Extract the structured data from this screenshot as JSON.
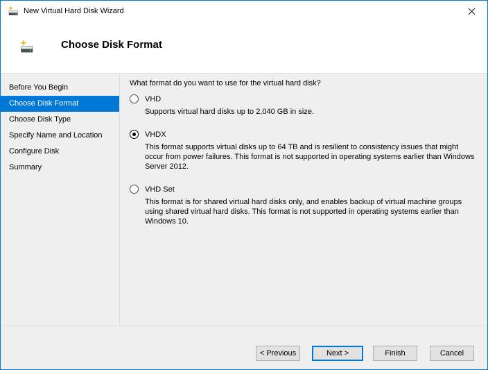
{
  "window": {
    "title": "New Virtual Hard Disk Wizard"
  },
  "icons": {
    "titlebar_app": "new-virtual-hard-disk-icon",
    "header": "new-virtual-hard-disk-icon",
    "close": "close-x-icon"
  },
  "header": {
    "title": "Choose Disk Format"
  },
  "sidebar": {
    "items": [
      {
        "label": "Before You Begin",
        "active": false
      },
      {
        "label": "Choose Disk Format",
        "active": true
      },
      {
        "label": "Choose Disk Type",
        "active": false
      },
      {
        "label": "Specify Name and Location",
        "active": false
      },
      {
        "label": "Configure Disk",
        "active": false
      },
      {
        "label": "Summary",
        "active": false
      }
    ]
  },
  "main": {
    "question": "What format do you want to use for the virtual hard disk?",
    "options": [
      {
        "label": "VHD",
        "selected": false,
        "description": "Supports virtual hard disks up to 2,040 GB in size."
      },
      {
        "label": "VHDX",
        "selected": true,
        "description": "This format supports virtual disks up to 64 TB and is resilient to consistency issues that might occur from power failures. This format is not supported in operating systems earlier than Windows Server 2012."
      },
      {
        "label": "VHD Set",
        "selected": false,
        "description": "This format is for shared virtual hard disks only, and enables backup of virtual machine groups using shared virtual hard disks. This format is not supported in operating systems earlier than Windows 10."
      }
    ]
  },
  "footer": {
    "buttons": [
      {
        "label": "< Previous",
        "default": false
      },
      {
        "label": "Next >",
        "default": true
      },
      {
        "label": "Finish",
        "default": false
      },
      {
        "label": "Cancel",
        "default": false
      }
    ]
  },
  "colors": {
    "accent": "#0078d7",
    "selection_bg": "#0078d7",
    "selection_text": "#ffffff",
    "dialog_bg": "#efefef",
    "button_face": "#e1e1e1",
    "button_border": "#adadad",
    "separator": "#dcdcdc"
  }
}
